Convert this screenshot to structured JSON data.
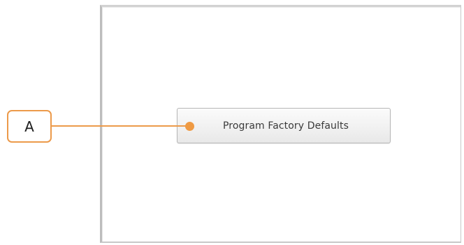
{
  "dialog": {
    "factory_defaults_button_label": "Program Factory Defaults"
  },
  "callout": {
    "label": "A",
    "color": "#ec9a4a"
  }
}
